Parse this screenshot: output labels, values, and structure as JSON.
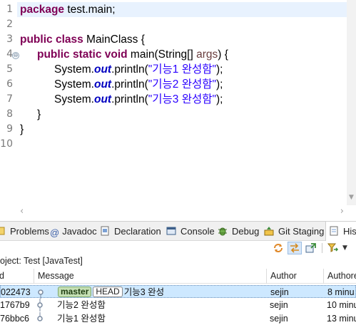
{
  "editor": {
    "line_numbers": [
      "1",
      "2",
      "3",
      "4",
      "5",
      "6",
      "7",
      "8",
      "9",
      "10"
    ],
    "package_kw": "package",
    "package_name": " test.main;",
    "class_kw": "public class",
    "class_name": " MainClass {",
    "method_kw": "public static void",
    "method_sig": " main(String[] ",
    "method_param": "args",
    "method_end": ") {",
    "println_lines": [
      {
        "pre": "System.",
        "field": "out",
        "call": ".println(",
        "arg": "\"기능1 완성함\"",
        "end": ");"
      },
      {
        "pre": "System.",
        "field": "out",
        "call": ".println(",
        "arg": "\"기능2 완성함\"",
        "end": ");"
      },
      {
        "pre": "System.",
        "field": "out",
        "call": ".println(",
        "arg": "\"기능3 완성함\"",
        "end": ");"
      }
    ],
    "close_method": "}",
    "close_class": "}",
    "fold_symbol": "⊖"
  },
  "tabs": [
    {
      "label": "Problems",
      "icon": "problems-icon"
    },
    {
      "label": "Javadoc",
      "icon": "javadoc-icon"
    },
    {
      "label": "Declaration",
      "icon": "declaration-icon"
    },
    {
      "label": "Console",
      "icon": "console-icon"
    },
    {
      "label": "Debug",
      "icon": "debug-icon"
    },
    {
      "label": "Git Staging",
      "icon": "git-staging-icon"
    },
    {
      "label": "Hist",
      "icon": "history-icon"
    }
  ],
  "history": {
    "project_label": "oject: Test [JavaTest]",
    "columns": {
      "id": "d",
      "message": "Message",
      "author": "Author",
      "authored": "Authore"
    },
    "rows": [
      {
        "id": "022473",
        "branch": "master",
        "head": "HEAD",
        "message": "기능3 완성",
        "author": "sejin",
        "time": "8 minu"
      },
      {
        "id": "1767b9",
        "message": "기능2 완성함",
        "author": "sejin",
        "time": "10 minu"
      },
      {
        "id": "76bbc6",
        "message": "기능1 완성함",
        "author": "sejin",
        "time": "13 minu"
      }
    ]
  },
  "colors": {
    "keyword": "#7f0055",
    "string": "#2a00ff",
    "field": "#0000c0",
    "current_line": "#e8f2fe",
    "selected_row": "#cde8ff"
  }
}
